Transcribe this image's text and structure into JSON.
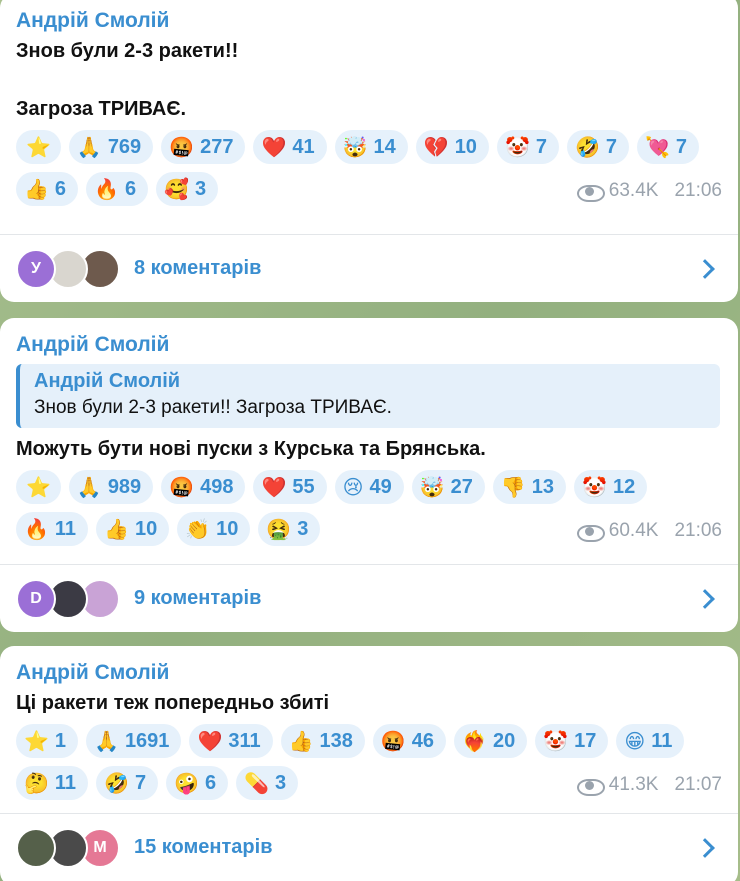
{
  "messages": [
    {
      "author": "Андрій Смолій",
      "lines": [
        "Знов були 2-3 ракети!!",
        "Загроза ТРИВАЄ."
      ],
      "reactions": [
        {
          "emoji": "⭐",
          "count": ""
        },
        {
          "emoji": "🙏",
          "count": "769"
        },
        {
          "emoji": "🤬",
          "count": "277"
        },
        {
          "emoji": "❤️",
          "count": "41"
        },
        {
          "emoji": "🤯",
          "count": "14"
        },
        {
          "emoji": "💔",
          "count": "10"
        },
        {
          "emoji": "🤡",
          "count": "7"
        },
        {
          "emoji": "🤣",
          "count": "7"
        },
        {
          "emoji": "💘",
          "count": "7"
        },
        {
          "emoji": "👍",
          "count": "6"
        },
        {
          "emoji": "🔥",
          "count": "6"
        },
        {
          "emoji": "🥰",
          "count": "3"
        }
      ],
      "views": "63.4K",
      "time": "21:06",
      "comments": "8 коментарів",
      "avatars": [
        {
          "letter": "У",
          "color": "#9b6fd6"
        },
        {
          "letter": "",
          "color": "#d9d6cf"
        },
        {
          "letter": "",
          "color": "#6e5a4d"
        }
      ]
    },
    {
      "author": "Андрій Смолій",
      "reply_author": "Андрій Смолій",
      "reply_text": "Знов були 2-3 ракети!!  Загроза ТРИВАЄ.",
      "lines": [
        "Можуть бути нові пуски з Курська та Брянська."
      ],
      "reactions": [
        {
          "emoji": "⭐",
          "count": ""
        },
        {
          "emoji": "🙏",
          "count": "989"
        },
        {
          "emoji": "🤬",
          "count": "498"
        },
        {
          "emoji": "❤️",
          "count": "55"
        },
        {
          "emoji": "😢",
          "count": "49"
        },
        {
          "emoji": "🤯",
          "count": "27"
        },
        {
          "emoji": "👎",
          "count": "13"
        },
        {
          "emoji": "🤡",
          "count": "12"
        },
        {
          "emoji": "🔥",
          "count": "11"
        },
        {
          "emoji": "👍",
          "count": "10"
        },
        {
          "emoji": "👏",
          "count": "10"
        },
        {
          "emoji": "🤮",
          "count": "3"
        }
      ],
      "views": "60.4K",
      "time": "21:06",
      "comments": "9 коментарів",
      "avatars": [
        {
          "letter": "D",
          "color": "#9b6fd6"
        },
        {
          "letter": "",
          "color": "#3b3a44"
        },
        {
          "letter": "",
          "color": "#c9a3d6"
        }
      ]
    },
    {
      "author": "Андрій Смолій",
      "lines": [
        "Ці ракети теж попередньо збиті"
      ],
      "reactions": [
        {
          "emoji": "⭐",
          "count": "1"
        },
        {
          "emoji": "🙏",
          "count": "1691"
        },
        {
          "emoji": "❤️",
          "count": "311"
        },
        {
          "emoji": "👍",
          "count": "138"
        },
        {
          "emoji": "🤬",
          "count": "46"
        },
        {
          "emoji": "❤️‍🔥",
          "count": "20"
        },
        {
          "emoji": "🤡",
          "count": "17"
        },
        {
          "emoji": "😁",
          "count": "11"
        },
        {
          "emoji": "🤔",
          "count": "11"
        },
        {
          "emoji": "🤣",
          "count": "7"
        },
        {
          "emoji": "🤪",
          "count": "6"
        },
        {
          "emoji": "💊",
          "count": "3"
        }
      ],
      "views": "41.3K",
      "time": "21:07",
      "comments": "15 коментарів",
      "avatars": [
        {
          "letter": "",
          "color": "#55604a"
        },
        {
          "letter": "",
          "color": "#4a4a4a"
        },
        {
          "letter": "M",
          "color": "#e57895"
        }
      ]
    }
  ]
}
